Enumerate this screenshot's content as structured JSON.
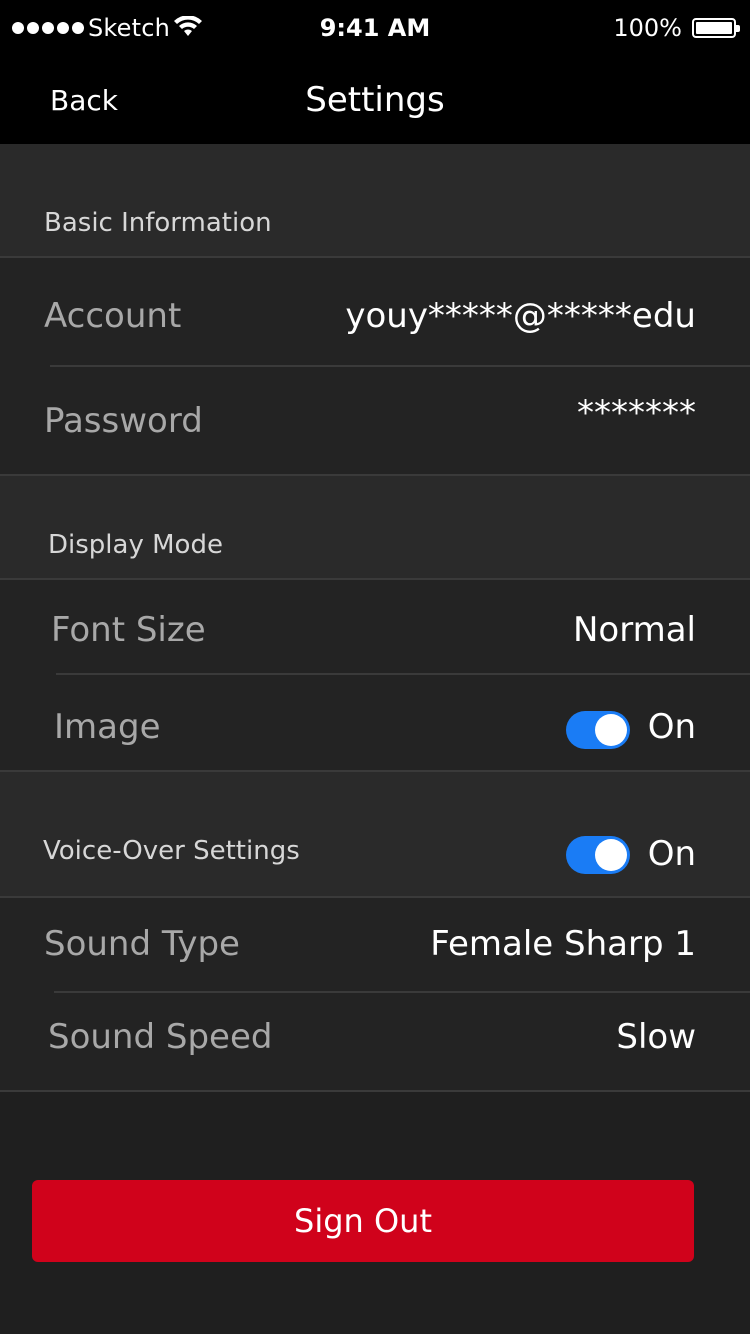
{
  "status_bar": {
    "carrier": "Sketch",
    "time": "9:41 AM",
    "battery_percent": "100%"
  },
  "nav": {
    "back_label": "Back",
    "title": "Settings"
  },
  "basic_information": {
    "header": "Basic Information",
    "account_label": "Account",
    "account_value": "youy*****@*****edu",
    "password_label": "Password",
    "password_value": "*******"
  },
  "display_mode": {
    "header": "Display Mode",
    "font_size_label": "Font Size",
    "font_size_value": "Normal",
    "image_label": "Image",
    "image_toggle_label": "On",
    "image_enabled": true
  },
  "voice_over": {
    "header": "Voice-Over Settings",
    "toggle_label": "On",
    "enabled": true,
    "sound_type_label": "Sound Type",
    "sound_type_value": "Female Sharp 1",
    "sound_speed_label": "Sound Speed",
    "sound_speed_value": "Slow"
  },
  "sign_out_label": "Sign Out",
  "colors": {
    "accent_toggle": "#1a7cf5",
    "sign_out": "#d0021b"
  }
}
